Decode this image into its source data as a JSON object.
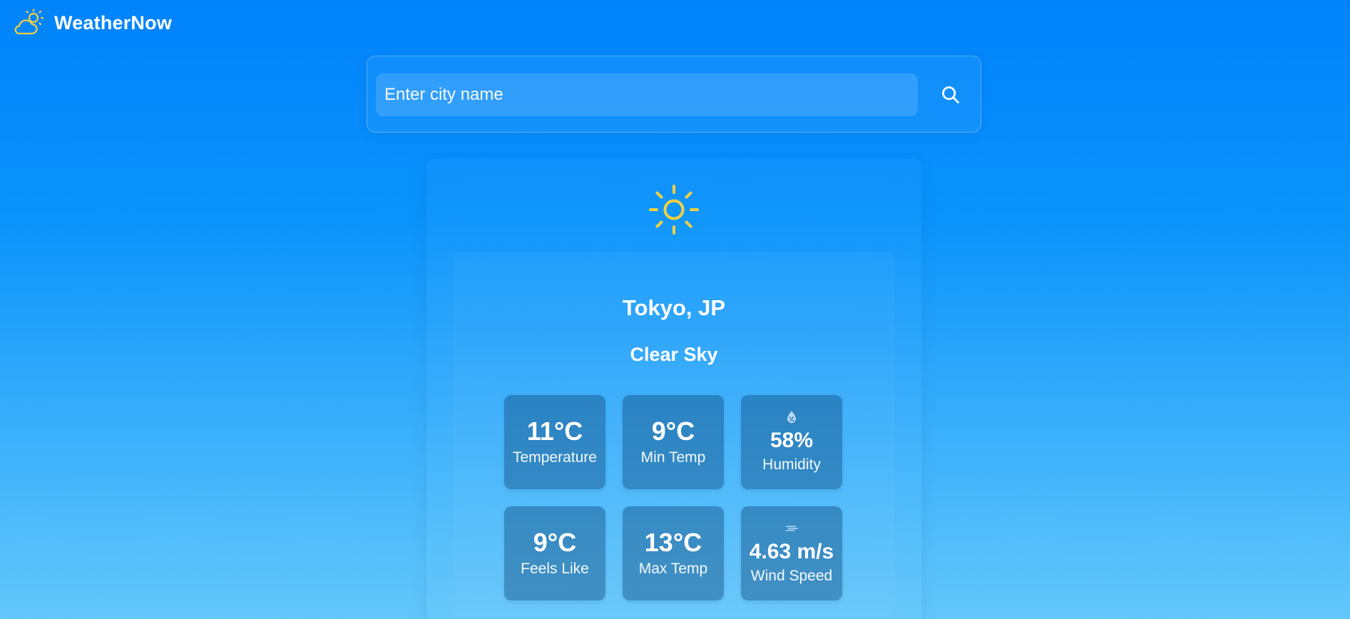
{
  "app": {
    "name": "WeatherNow",
    "logo_icon": "cloud-sun-icon",
    "accent_color": "#f4d03f"
  },
  "search": {
    "placeholder": "Enter city name",
    "value": "",
    "button_icon": "search-icon"
  },
  "weather": {
    "icon": "sun-icon",
    "city": "Tokyo, JP",
    "condition": "Clear Sky",
    "stats": {
      "temperature": {
        "value": "11°C",
        "label": "Temperature"
      },
      "min_temp": {
        "value": "9°C",
        "label": "Min Temp"
      },
      "humidity": {
        "value": "58%",
        "label": "Humidity",
        "icon": "humidity-drop-icon"
      },
      "feels_like": {
        "value": "9°C",
        "label": "Feels Like"
      },
      "max_temp": {
        "value": "13°C",
        "label": "Max Temp"
      },
      "wind_speed": {
        "value": "4.63 m/s",
        "label": "Wind Speed",
        "icon": "wind-icon"
      }
    }
  }
}
